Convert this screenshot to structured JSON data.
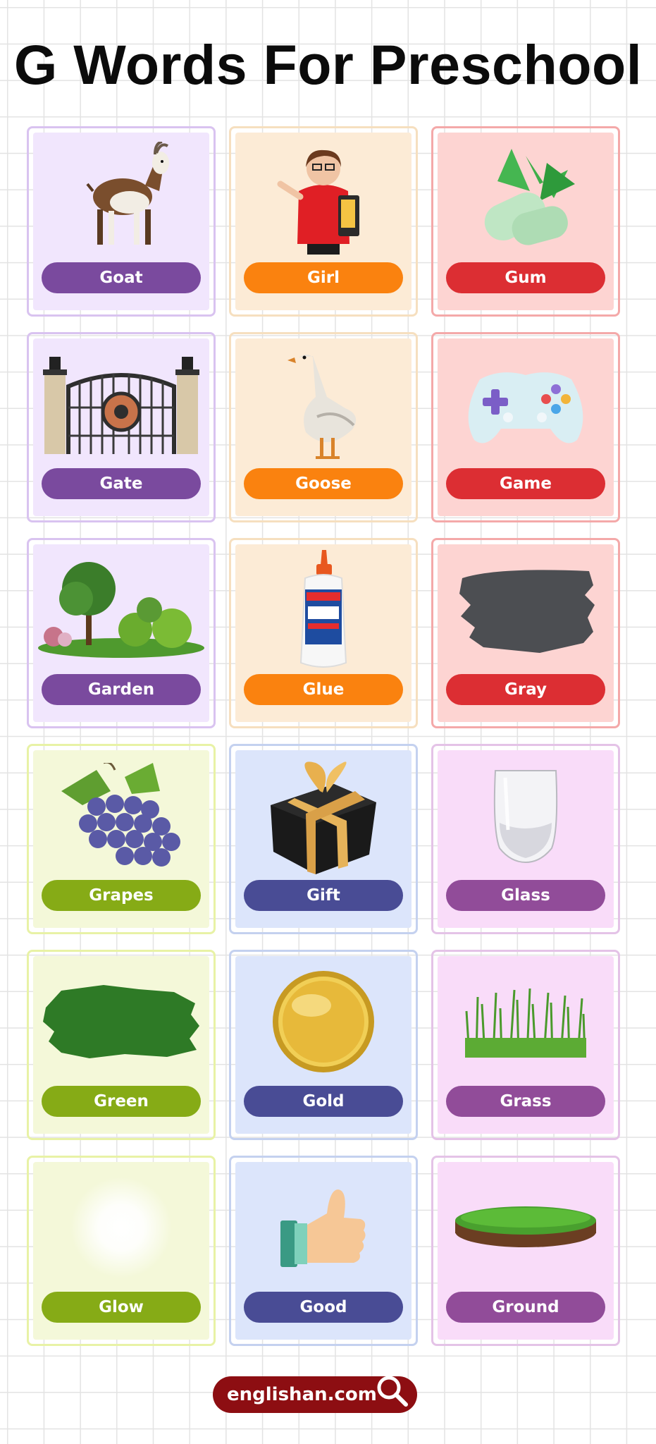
{
  "title": "G Words For Preschool",
  "colors": {
    "purple": {
      "bg": "#f1e6fd",
      "border": "#d9c3f0",
      "pill": "#7a4a9e"
    },
    "orange": {
      "bg": "#fcebd6",
      "border": "#f6dfbf",
      "pill": "#fa820f"
    },
    "red": {
      "bg": "#fdd4d2",
      "border": "#f4a9a9",
      "pill": "#dc2e33"
    },
    "green": {
      "bg": "#f4f8d9",
      "border": "#e8f2a6",
      "pill": "#86ab16"
    },
    "blue": {
      "bg": "#dce5fb",
      "border": "#c4d1ef",
      "pill": "#494c95"
    },
    "pink": {
      "bg": "#f9dcf9",
      "border": "#e4c3e7",
      "pill": "#914c99"
    }
  },
  "cards": [
    {
      "label": "Goat",
      "icon": "goat-icon",
      "theme": "purple"
    },
    {
      "label": "Girl",
      "icon": "girl-icon",
      "theme": "orange"
    },
    {
      "label": "Gum",
      "icon": "gum-icon",
      "theme": "red"
    },
    {
      "label": "Gate",
      "icon": "gate-icon",
      "theme": "purple"
    },
    {
      "label": "Goose",
      "icon": "goose-icon",
      "theme": "orange"
    },
    {
      "label": "Game",
      "icon": "game-controller-icon",
      "theme": "red"
    },
    {
      "label": "Garden",
      "icon": "garden-icon",
      "theme": "purple"
    },
    {
      "label": "Glue",
      "icon": "glue-bottle-icon",
      "theme": "orange"
    },
    {
      "label": "Gray",
      "icon": "gray-paint-icon",
      "theme": "red"
    },
    {
      "label": "Grapes",
      "icon": "grapes-icon",
      "theme": "green"
    },
    {
      "label": "Gift",
      "icon": "gift-icon",
      "theme": "blue"
    },
    {
      "label": "Glass",
      "icon": "glass-icon",
      "theme": "pink"
    },
    {
      "label": "Green",
      "icon": "green-paint-icon",
      "theme": "green"
    },
    {
      "label": "Gold",
      "icon": "gold-coin-icon",
      "theme": "blue"
    },
    {
      "label": "Grass",
      "icon": "grass-icon",
      "theme": "pink"
    },
    {
      "label": "Glow",
      "icon": "glow-icon",
      "theme": "green"
    },
    {
      "label": "Good",
      "icon": "thumbs-up-icon",
      "theme": "blue"
    },
    {
      "label": "Ground",
      "icon": "ground-icon",
      "theme": "pink"
    }
  ],
  "footer": {
    "text": "englishan.com",
    "icon": "magnifier-icon"
  }
}
